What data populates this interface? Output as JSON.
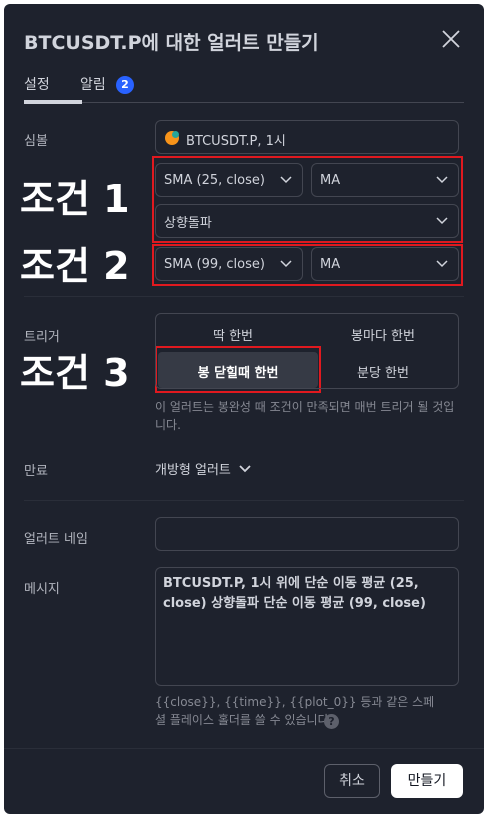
{
  "dialog": {
    "title": "BTCUSDT.P에 대한 얼러트 만들기",
    "tabs": [
      {
        "label": "설정",
        "active": true
      },
      {
        "label": "알림",
        "badge": "2"
      }
    ]
  },
  "symbol": {
    "label": "심볼",
    "value": "BTCUSDT.P, 1시"
  },
  "condition": {
    "row1_left": "SMA (25, close)",
    "row1_right": "MA",
    "row2": "상향돌파",
    "row3_left": "SMA (99, close)",
    "row3_right": "MA"
  },
  "annotations": {
    "cond1": "조건 1",
    "cond2": "조건 2",
    "cond3": "조건 3"
  },
  "trigger": {
    "label": "트리거",
    "options": [
      "딱 한번",
      "봉마다 한번",
      "봉 닫힐때 한번",
      "분당 한번"
    ],
    "selected": "봉 닫힐때 한번",
    "description": "이 얼러트는 봉완성 때 조건이 만족되면 매번 트리거 될 것입니다."
  },
  "expiration": {
    "label": "만료",
    "value": "개방형 얼러트"
  },
  "alert_name": {
    "label": "얼러트 네임",
    "value": ""
  },
  "message": {
    "label": "메시지",
    "value": "BTCUSDT.P, 1시 위에 단순 이동 평균 (25, close) 상향돌파 단순 이동 평균 (99, close)",
    "hint": "{{close}}, {{time}}, {{plot_0}} 등과 같은 스페셜 플레이스 홀더를 쓸 수 있습니다."
  },
  "footer": {
    "cancel": "취소",
    "create": "만들기"
  },
  "colors": {
    "background": "#1e222d",
    "accent": "#2962ff",
    "annotation_border": "#e0191f"
  }
}
